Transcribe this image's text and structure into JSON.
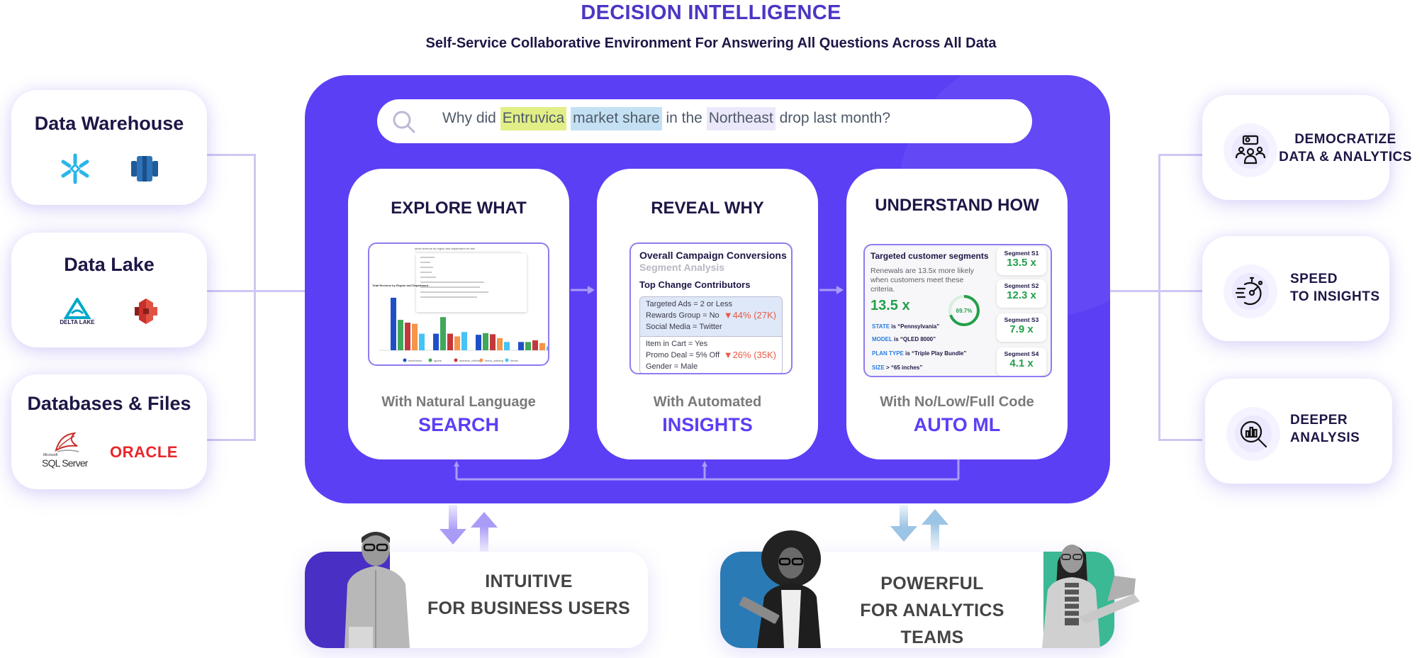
{
  "header": {
    "title": "DECISION INTELLIGENCE",
    "subtitle": "Self-Service Collaborative Environment For Answering All Questions Across All Data"
  },
  "sources": [
    {
      "label": "Data Warehouse",
      "logos": [
        "snowflake-logo",
        "amazon-redshift-logo"
      ]
    },
    {
      "label": "Data Lake",
      "logos": [
        "delta-lake-logo",
        "amazon-s3-logo"
      ],
      "delta_text": "DELTA LAKE"
    },
    {
      "label": "Databases & Files",
      "logos": [
        "sql-server-logo",
        "oracle-logo"
      ],
      "sql_text": "SQL Server",
      "sql_small": "Microsoft",
      "oracle_text": "ORACLE"
    }
  ],
  "search": {
    "icon": "search-icon",
    "parts": [
      {
        "text": "Why did ",
        "highlight": "none"
      },
      {
        "text": "Entruvica",
        "highlight": "yellow"
      },
      {
        "text": " ",
        "highlight": "none"
      },
      {
        "text": "market share",
        "highlight": "blue"
      },
      {
        "text": " in the ",
        "highlight": "none"
      },
      {
        "text": "Northeast",
        "highlight": "lavender"
      },
      {
        "text": " drop last month?",
        "highlight": "none"
      }
    ]
  },
  "features": [
    {
      "title": "EXPLORE WHAT",
      "subtitle": "With Natural Language",
      "label": "SEARCH"
    },
    {
      "title": "REVEAL WHY",
      "subtitle": "With Automated",
      "label": "INSIGHTS"
    },
    {
      "title": "UNDERSTAND HOW",
      "subtitle": "With No/Low/Full Code",
      "label": "AUTO ML"
    }
  ],
  "explore_shot": {
    "query": "show revenue by region and department for last",
    "chart_title": "Total Revenue by Region and Department",
    "legend": [
      "electronics",
      "sports",
      "womens_clothing",
      "mens_clothing",
      "shoes"
    ],
    "colors": [
      "#1f4fc7",
      "#3fa85a",
      "#c4383a",
      "#f5944a",
      "#45c4f5"
    ]
  },
  "reveal_shot": {
    "title": "Overall Campaign Conversions",
    "subtitle": "Segment Analysis",
    "section": "Top Change Contributors",
    "rows": [
      {
        "lines": [
          "Targeted Ads = 2 or Less",
          "Rewards Group = No",
          "Social Media = Twitter"
        ],
        "value": "▼44% (27K)"
      },
      {
        "lines": [
          "Item in Cart = Yes",
          "Promo Deal = 5% Off",
          "Gender = Male"
        ],
        "value": "▼26% (35K)"
      }
    ]
  },
  "understand_shot": {
    "title": "Targeted customer segments",
    "description": "Renewals are 13.5x more likely when customers meet these criteria.",
    "big_value": "13.5 x",
    "donut_label": "69.7%",
    "donut_fraction": 0.697,
    "criteria": [
      {
        "key": "STATE",
        "rest": " is “Pennsylvania”"
      },
      {
        "key": "MODEL",
        "rest": " is “QLED 8000”"
      },
      {
        "key": "PLAN TYPE",
        "rest": " is “Triple Play Bundle”"
      },
      {
        "key": "SIZE",
        "rest": "  > “65 inches”"
      }
    ],
    "segments": [
      {
        "label": "Segment S1",
        "value": "13.5 x"
      },
      {
        "label": "Segment S2",
        "value": "12.3 x"
      },
      {
        "label": "Segment S3",
        "value": "7.9 x"
      },
      {
        "label": "Segment S4",
        "value": "4.1 x"
      }
    ]
  },
  "benefits": [
    {
      "lines": [
        "DEMOCRATIZE",
        "DATA & ANALYTICS"
      ],
      "icon": "team-search-icon"
    },
    {
      "lines": [
        "SPEED",
        "TO INSIGHTS"
      ],
      "icon": "stopwatch-icon"
    },
    {
      "lines": [
        "DEEPER",
        "ANALYSIS"
      ],
      "icon": "magnify-chart-icon"
    }
  ],
  "personas": [
    {
      "lines": [
        "INTUITIVE",
        "FOR BUSINESS USERS"
      ],
      "accent": "#4a2fc4"
    },
    {
      "lines": [
        "POWERFUL",
        "FOR ANALYTICS TEAMS"
      ],
      "accent_left": "#2a7bb5",
      "accent_right": "#3bb894"
    }
  ],
  "colors": {
    "brand": "#5b3ff5",
    "title": "#4b36c4",
    "dark_text": "#1d1746",
    "positive": "#22a04a",
    "negative": "#e95a45"
  }
}
